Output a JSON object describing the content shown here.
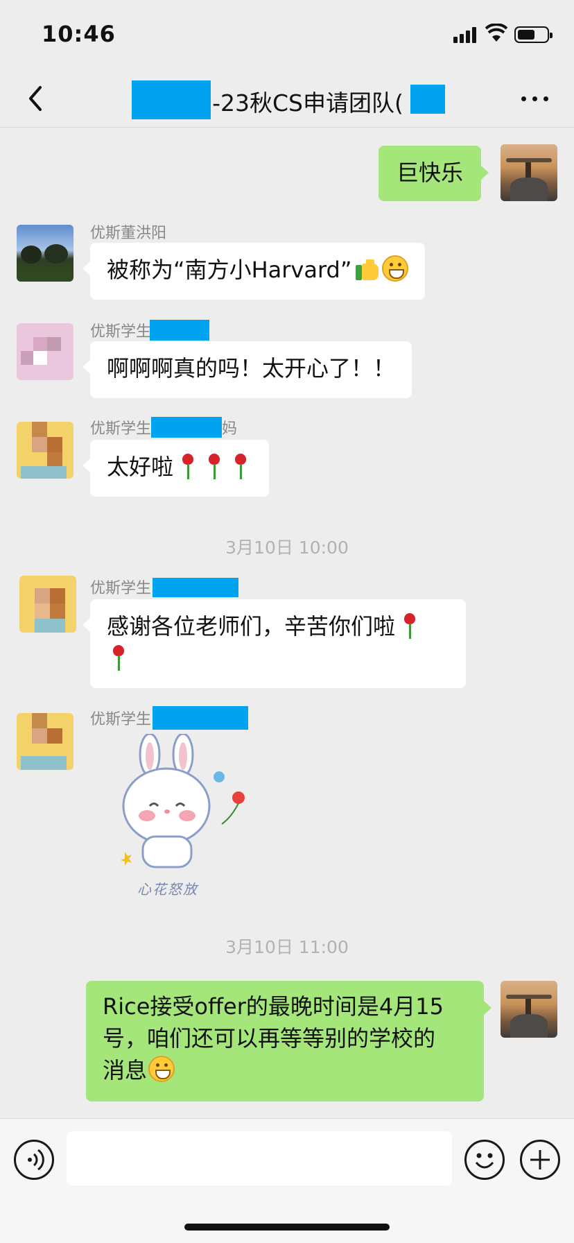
{
  "status_bar": {
    "time": "10:46",
    "battery_level": 0.5
  },
  "header": {
    "title": "-23秋CS申请团队(",
    "back_icon": "chevron-left-icon",
    "more_icon": "more-icon"
  },
  "messages": [
    {
      "side": "right",
      "text": "巨快乐"
    },
    {
      "side": "left",
      "sender": "优斯董洪阳",
      "text": "被称为“南方小Harvard”",
      "trailing_emoji": [
        "thumbs-up-icon",
        "grin-icon"
      ]
    },
    {
      "side": "left",
      "sender": "优斯学生",
      "text": "啊啊啊真的吗！太开心了！！"
    },
    {
      "side": "left",
      "sender": "优斯学生",
      "sender_suffix": "妈",
      "text": "太好啦",
      "trailing_emoji": [
        "rose-icon",
        "rose-icon",
        "rose-icon"
      ]
    },
    {
      "timestamp": "3月10日 10:00"
    },
    {
      "side": "left",
      "sender": "优斯学生",
      "text": "感谢各位老师们，辛苦你们啦",
      "trailing_emoji": [
        "rose-icon",
        "rose-icon"
      ]
    },
    {
      "side": "left",
      "sender": "优斯学生",
      "sticker": "bunny-sticker",
      "sticker_caption": "心花怒放"
    },
    {
      "timestamp": "3月10日 11:00"
    },
    {
      "side": "right",
      "text_lines": [
        "Rice接受offer的最晚时间是4月15",
        "号，咱们还可以再等等别的学校的",
        "消息"
      ],
      "trailing_emoji": [
        "grin-icon"
      ]
    }
  ],
  "input_bar": {
    "voice_icon": "voice-icon",
    "emoji_icon": "emoji-icon",
    "plus_icon": "plus-icon",
    "input_value": ""
  }
}
